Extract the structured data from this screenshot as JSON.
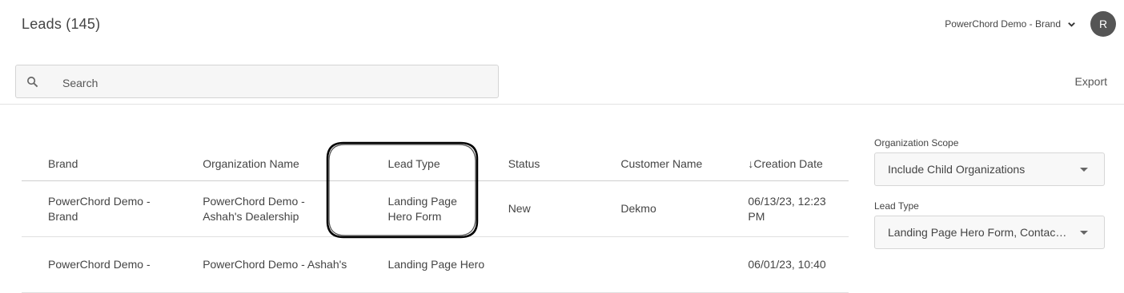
{
  "header": {
    "title": "Leads",
    "count": "(145)",
    "org_name": "PowerChord Demo - Brand",
    "avatar_initial": "R"
  },
  "search": {
    "placeholder": "Search"
  },
  "toolbar": {
    "export_label": "Export"
  },
  "table": {
    "columns": [
      "Brand",
      "Organization Name",
      "Lead Type",
      "Status",
      "Customer Name",
      "↓Creation Date"
    ],
    "rows": [
      {
        "brand": "PowerChord Demo - Brand",
        "org": "PowerChord Demo - Ashah's Dealership",
        "type": "Landing Page Hero Form",
        "status": "New",
        "customer": "Dekmo",
        "date": "06/13/23, 12:23 PM"
      },
      {
        "brand": "PowerChord Demo -",
        "org": "PowerChord Demo - Ashah's",
        "type": "Landing Page Hero",
        "status": "",
        "customer": "",
        "date": "06/01/23, 10:40"
      }
    ]
  },
  "filters": {
    "org_scope": {
      "label": "Organization Scope",
      "value": "Include Child Organizations"
    },
    "lead_type": {
      "label": "Lead Type",
      "value": "Landing Page Hero Form, Contact…"
    }
  },
  "colors": {
    "avatar": "#555555",
    "annotation": "#000000"
  }
}
